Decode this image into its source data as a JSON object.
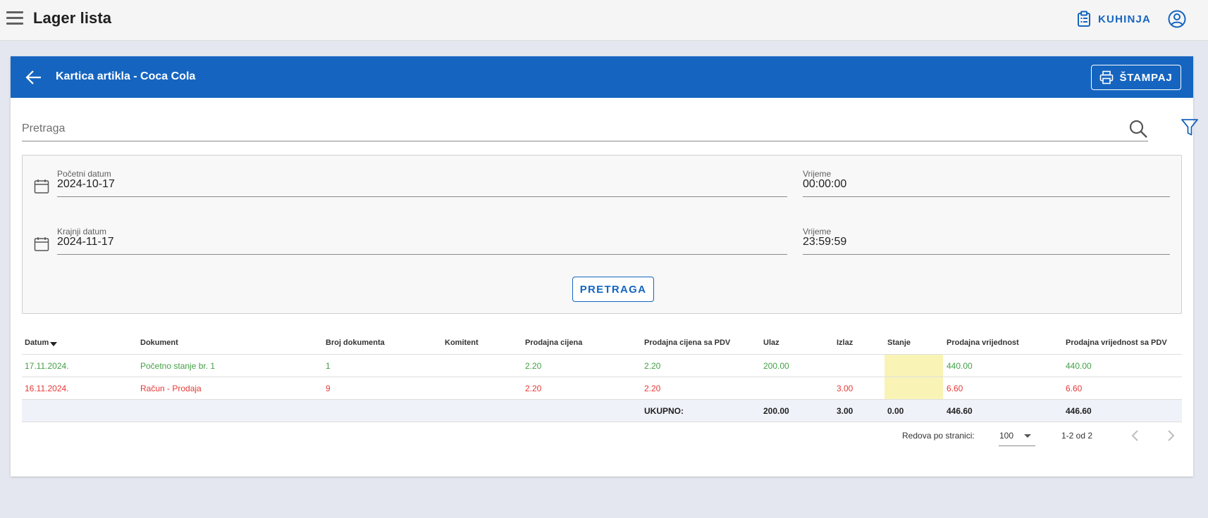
{
  "app": {
    "title": "Lager lista",
    "kitchen_label": "KUHINJA"
  },
  "card": {
    "title": "Kartica artikla - Coca Cola",
    "print_label": "ŠTAMPAJ"
  },
  "search": {
    "placeholder": "Pretraga"
  },
  "filters": {
    "start_date": {
      "label": "Početni datum",
      "value": "2024-10-17"
    },
    "start_time": {
      "label": "Vrijeme",
      "value": "00:00:00"
    },
    "end_date": {
      "label": "Krajnji datum",
      "value": "2024-11-17"
    },
    "end_time": {
      "label": "Vrijeme",
      "value": "23:59:59"
    },
    "search_button": "PRETRAGA"
  },
  "table": {
    "headers": [
      "Datum",
      "Dokument",
      "Broj dokumenta",
      "Komitent",
      "Prodajna cijena",
      "Prodajna cijena sa PDV",
      "Ulaz",
      "Izlaz",
      "Stanje",
      "Prodajna vrijednost",
      "Prodajna vrijednost sa PDV"
    ],
    "rows": [
      {
        "datum": "17.11.2024.",
        "dokument": "Početno stanje br. 1",
        "broj": "1",
        "komitent": "",
        "cijena": "2.20",
        "cijena_pdv": "2.20",
        "ulaz": "200.00",
        "izlaz": "",
        "stanje": "",
        "vrijednost": "440.00",
        "vrijednost_pdv": "440.00"
      },
      {
        "datum": "16.11.2024.",
        "dokument": "Račun - Prodaja",
        "broj": "9",
        "komitent": "",
        "cijena": "2.20",
        "cijena_pdv": "2.20",
        "ulaz": "",
        "izlaz": "3.00",
        "stanje": "",
        "vrijednost": "6.60",
        "vrijednost_pdv": "6.60"
      }
    ],
    "totals": {
      "label": "UKUPNO:",
      "ulaz": "200.00",
      "izlaz": "3.00",
      "stanje": "0.00",
      "vrijednost": "446.60",
      "vrijednost_pdv": "446.60"
    }
  },
  "pagination": {
    "rows_per_page_label": "Redova po stranici:",
    "rows_per_page": "100",
    "range": "1-2 od 2"
  },
  "colors": {
    "primary": "#1565c0",
    "in": "#43a047",
    "out": "#e53935",
    "stanje_highlight": "#f9f4b6"
  }
}
